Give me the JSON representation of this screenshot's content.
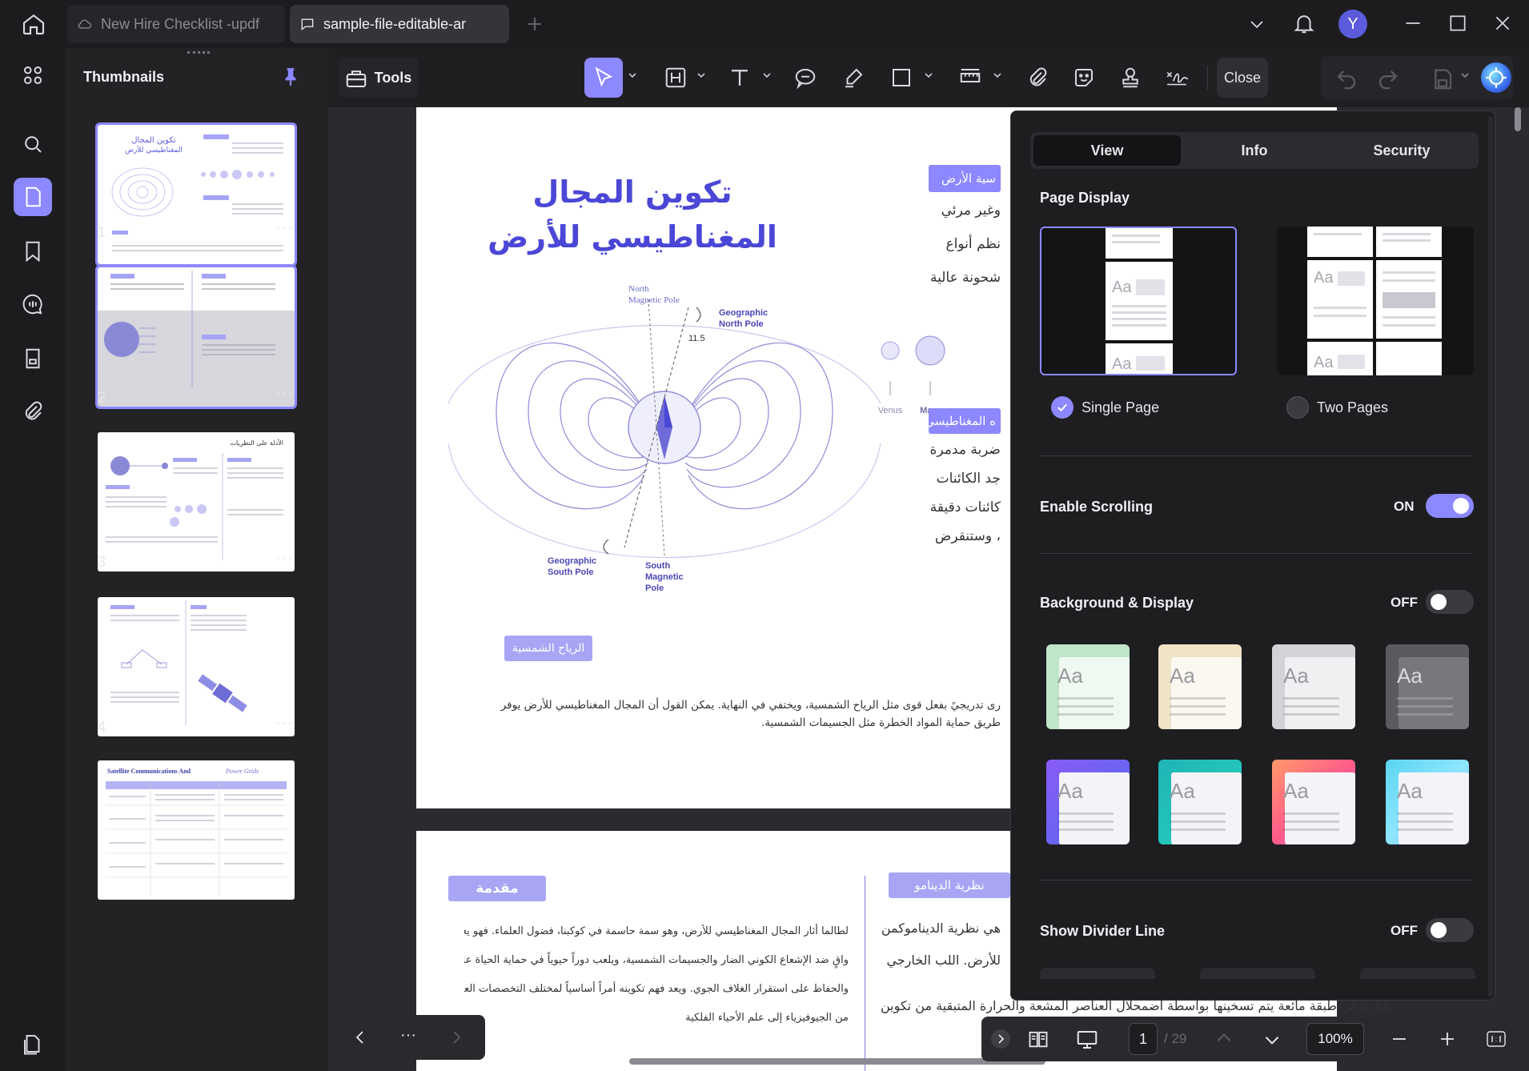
{
  "tabs": [
    {
      "label": "New Hire Checklist -updf"
    },
    {
      "label": "sample-file-editable-ar"
    }
  ],
  "user": {
    "avatar_letter": "Y"
  },
  "thumbnails": {
    "title": "Thumbnails",
    "pages": [
      {
        "number": "1",
        "more": "···"
      },
      {
        "number": "2",
        "more": "···"
      },
      {
        "number": "3",
        "more": "···"
      },
      {
        "number": "4",
        "more": "···"
      },
      {
        "number": "5",
        "more": ""
      }
    ],
    "thumb5_title_a": "Satellite Communications And",
    "thumb5_title_b": "Power Grids",
    "thumb3_title": "الأدلة على النظريات"
  },
  "toolbar": {
    "tools_label": "Tools",
    "close_label": "Close"
  },
  "page1": {
    "title_line1": "تكوين المجال",
    "title_line2": "المغناطيسي للأرض",
    "label_north_magnetic": "North",
    "label_north_magnetic2": "Magnetic Pole",
    "label_geo_north": "Geographic",
    "label_geo_north2": "North Pole",
    "label_geo_south": "Geographic",
    "label_geo_south2": "South Pole",
    "label_south_magnetic": "South",
    "label_south_magnetic2": "Magnetic",
    "label_south_magnetic3": "Pole",
    "angle": "11.5",
    "planet_venus": "Venus",
    "planet_mars": "Mars",
    "badge_top": "سية الأرض",
    "right_lines_top": [
      "وغير مرئي",
      "نظم أنواع",
      "شحونة عالية"
    ],
    "badge_mid": "ه المغناطيسي",
    "right_lines_mid": [
      "ضربة مدمرة",
      "جد الكائنات",
      "كائنات دقيقة",
      "، وستنقرض"
    ],
    "badge_bottom": "الرياح الشمسية",
    "para_line1": "رى تدريجيً بفعل قوى مثل الرياح الشمسية، ويختفي في النهاية. يمكن القول أن المجال المغناطيسي للأرض يوفر",
    "para_line2": "طريق حماية المواد الخطرة مثل الجسيمات الشمسية."
  },
  "page2": {
    "badge_intro": "مقدمة",
    "badge_dynamo": "نظرية الدينامو",
    "intro_lines": [
      "لطالما أثار المجال المغناطيسي للأرض، وهو سمة حاسمة في كوكبنا، فضول العلماء. فهو يعمل كدرع",
      "واقٍ ضد الإشعاع الكوني الضار والجسيمات الشمسية، ويلعب دوراً حيوياً في حماية الحياة على الأرض",
      "والحفاظ على استقرار الغلاف الجوي. ويعد فهم تكوينه أمراً أساسياً لمختلف التخصصات العلمية، بدءًا",
      "من الجيوفيزياء إلى علم الأحياء الفلكية"
    ],
    "dynamo_lines": [
      "هي نظرية الديناموكمن",
      "للأرض. اللب الخارجي",
      "عبارة عن طبقة مائعة يتم تسخينها بواسطة اضمحلال العناصر المشعة والحرارة المتبقية من تكوين"
    ]
  },
  "panel": {
    "tabs": [
      "View",
      "Info",
      "Security"
    ],
    "active_tab": "View",
    "page_display_label": "Page Display",
    "single_page_label": "Single Page",
    "two_pages_label": "Two Pages",
    "selected_display": "Single Page",
    "enable_scrolling_label": "Enable Scrolling",
    "enable_scrolling_state": "ON",
    "background_label": "Background & Display",
    "background_state": "OFF",
    "divider_label": "Show Divider Line",
    "divider_state": "OFF",
    "swatch_text": "Aa",
    "accent_color": "#8c88ff",
    "swatches": [
      "mint",
      "cream",
      "light-gray",
      "dark-gray",
      "purple-gradient",
      "teal-gradient",
      "sunset-gradient",
      "sky-gradient"
    ]
  },
  "statusbar": {
    "page_current": "1",
    "page_total": "/ 29",
    "zoom": "100%",
    "more": "···"
  }
}
